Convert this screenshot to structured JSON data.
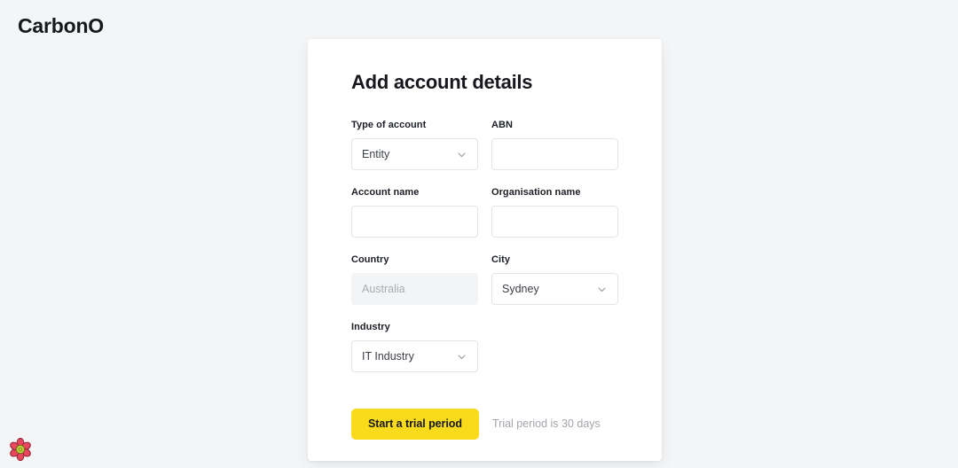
{
  "brand": {
    "name": "CarbonO"
  },
  "card": {
    "title": "Add account details",
    "fields": [
      {
        "label": "Type of account",
        "type": "select",
        "value": "Entity",
        "icon": "chevron-down-icon",
        "name": "type-of-account"
      },
      {
        "label": "ABN",
        "type": "text",
        "value": "",
        "placeholder": "",
        "name": "abn"
      },
      {
        "label": "Account name",
        "type": "text",
        "value": "",
        "placeholder": "",
        "name": "account-name"
      },
      {
        "label": "Organisation name",
        "type": "text",
        "value": "",
        "placeholder": "",
        "name": "organisation-name"
      },
      {
        "label": "Country",
        "type": "text-disabled",
        "value": "Australia",
        "placeholder": "Australia",
        "name": "country"
      },
      {
        "label": "City",
        "type": "select",
        "value": "Sydney",
        "icon": "chevron-down-icon",
        "name": "city"
      },
      {
        "label": "Industry",
        "type": "select",
        "value": "IT Industry",
        "icon": "chevron-down-icon",
        "name": "industry"
      }
    ],
    "action": {
      "button_label": "Start a trial period",
      "helper_text": "Trial period is 30 days"
    }
  },
  "decoration": {
    "flower_icon": "flower-icon"
  },
  "colors": {
    "page_background": "#f4f5f6",
    "card_background": "#ffffff",
    "accent_yellow": "#fadb1c",
    "text_primary": "#16181d",
    "text_muted": "#a2a5ab",
    "border": "#e3e5e9",
    "disabled_fill": "#f3f4f6",
    "flower_petal": "#e8475e",
    "flower_center": "#c3d43a"
  }
}
